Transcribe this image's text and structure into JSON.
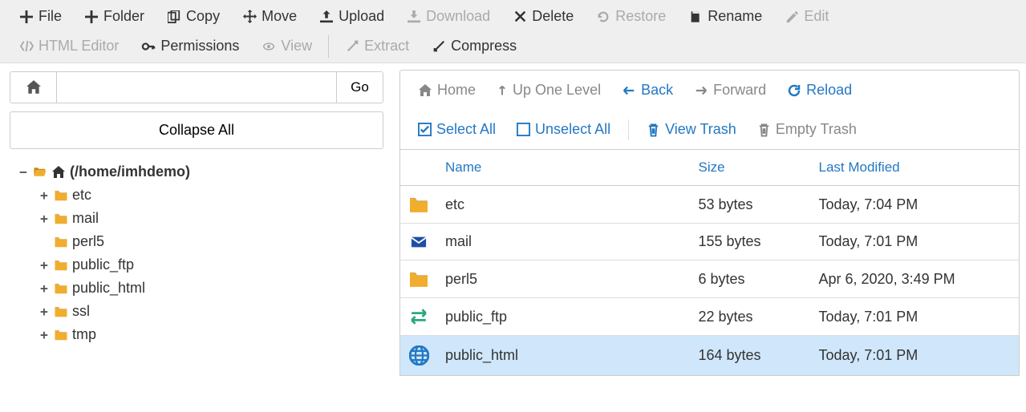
{
  "toolbar": {
    "file": "File",
    "folder": "Folder",
    "copy": "Copy",
    "move": "Move",
    "upload": "Upload",
    "download": "Download",
    "delete": "Delete",
    "restore": "Restore",
    "rename": "Rename",
    "edit": "Edit",
    "html_editor": "HTML Editor",
    "permissions": "Permissions",
    "view": "View",
    "extract": "Extract",
    "compress": "Compress"
  },
  "left": {
    "go": "Go",
    "collapse_all": "Collapse All",
    "path_value": "",
    "root": "(/home/imhdemo)",
    "tree": [
      {
        "name": "etc",
        "expandable": true
      },
      {
        "name": "mail",
        "expandable": true
      },
      {
        "name": "perl5",
        "expandable": false
      },
      {
        "name": "public_ftp",
        "expandable": true
      },
      {
        "name": "public_html",
        "expandable": true
      },
      {
        "name": "ssl",
        "expandable": true
      },
      {
        "name": "tmp",
        "expandable": true
      }
    ]
  },
  "nav": {
    "home": "Home",
    "up": "Up One Level",
    "back": "Back",
    "forward": "Forward",
    "reload": "Reload",
    "select_all": "Select All",
    "unselect_all": "Unselect All",
    "view_trash": "View Trash",
    "empty_trash": "Empty Trash"
  },
  "table": {
    "headers": {
      "name": "Name",
      "size": "Size",
      "modified": "Last Modified"
    },
    "rows": [
      {
        "icon": "folder",
        "name": "etc",
        "size": "53 bytes",
        "modified": "Today, 7:04 PM",
        "selected": false
      },
      {
        "icon": "mail",
        "name": "mail",
        "size": "155 bytes",
        "modified": "Today, 7:01 PM",
        "selected": false
      },
      {
        "icon": "folder",
        "name": "perl5",
        "size": "6 bytes",
        "modified": "Apr 6, 2020, 3:49 PM",
        "selected": false
      },
      {
        "icon": "ftp",
        "name": "public_ftp",
        "size": "22 bytes",
        "modified": "Today, 7:01 PM",
        "selected": false
      },
      {
        "icon": "globe",
        "name": "public_html",
        "size": "164 bytes",
        "modified": "Today, 7:01 PM",
        "selected": true
      }
    ]
  },
  "colors": {
    "accent": "#2378c3",
    "folder": "#f0ad2e",
    "mail": "#1f4fa3",
    "ftp": "#2aa87a",
    "disabled": "#aaa"
  }
}
